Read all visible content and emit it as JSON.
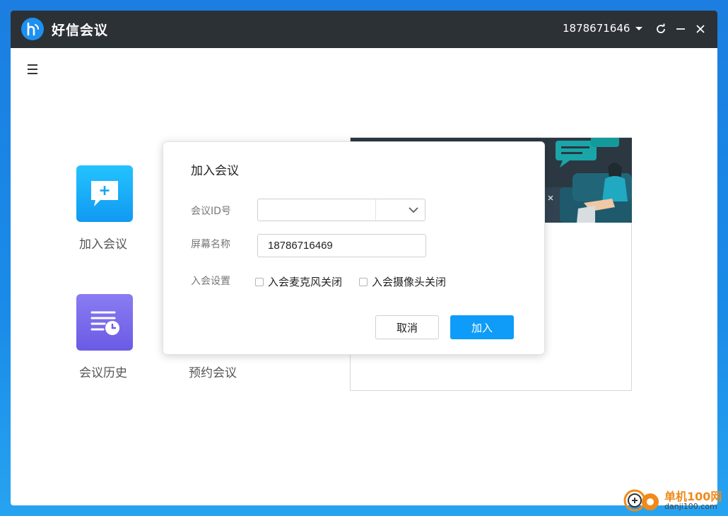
{
  "app": {
    "title": "好信会议"
  },
  "titlebar": {
    "account": "1878671646"
  },
  "home": {
    "tiles": [
      {
        "label": "加入会议",
        "icon": "chat-plus-icon",
        "color": "#1aa8f5"
      },
      {
        "label": "会议历史",
        "icon": "list-clock-icon",
        "color": "#7565ea"
      }
    ],
    "schedule_label": "预约会议"
  },
  "dialog": {
    "title": "加入会议",
    "meeting_id_label": "会议ID号",
    "meeting_id_value": "",
    "display_name_label": "屏幕名称",
    "display_name_value": "18786716469",
    "settings_label": "入会设置",
    "mute_mic_label": "入会麦克风关闭",
    "mute_mic_checked": false,
    "camera_off_label": "入会摄像头关闭",
    "camera_off_checked": false,
    "cancel_label": "取消",
    "join_label": "加入"
  },
  "watermark": {
    "site": "单机100网",
    "domain": "danji100.com"
  },
  "colors": {
    "titlebar": "#2c3136",
    "primary": "#0f9cf8",
    "desktop": "#1a8be8"
  }
}
